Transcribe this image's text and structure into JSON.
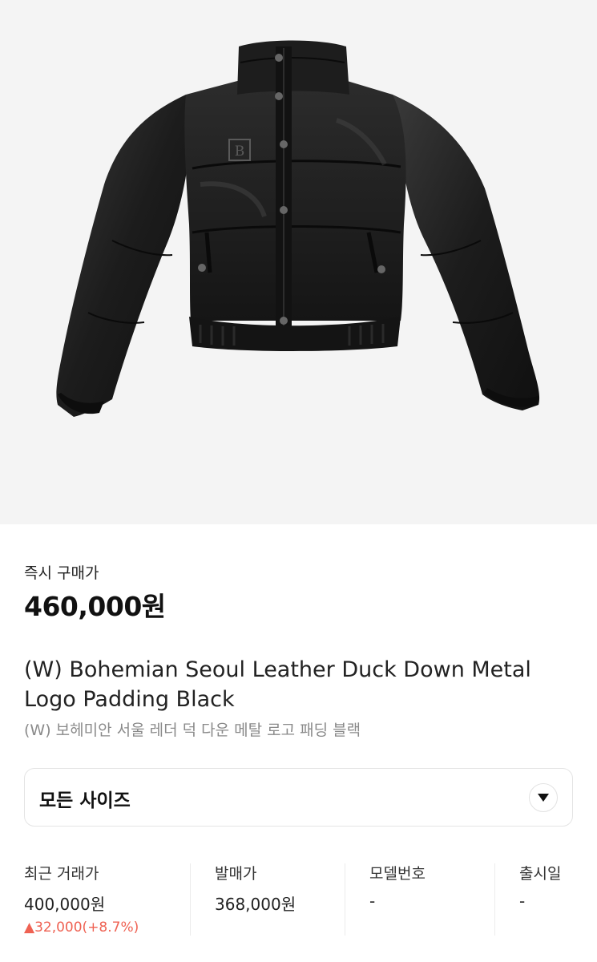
{
  "product": {
    "image_alt": "Bohemian Seoul leather duck down padding jacket, black",
    "instant_price_label": "즉시 구매가",
    "instant_price": "460,000원",
    "title_en": "(W) Bohemian Seoul Leather Duck Down Metal Logo Padding Black",
    "title_ko": "(W) 보헤미안 서울 레더 덕 다운 메탈 로고 패딩 블랙",
    "logo_letter": "B"
  },
  "size_selector": {
    "label": "모든 사이즈",
    "arrow_icon": "caret-down-icon"
  },
  "stats": {
    "recent_trade": {
      "label": "최근 거래가",
      "value": "400,000원",
      "change": "▲32,000(+8.7%)"
    },
    "release_price": {
      "label": "발매가",
      "value": "368,000원"
    },
    "model_no": {
      "label": "모델번호",
      "value": "-"
    },
    "release_date": {
      "label": "출시일",
      "value": "-"
    }
  },
  "colors": {
    "image_background": "#f4f4f4",
    "price_up": "#ef6253",
    "border": "#e4e4e4",
    "muted_text": "#8a8a8a"
  }
}
